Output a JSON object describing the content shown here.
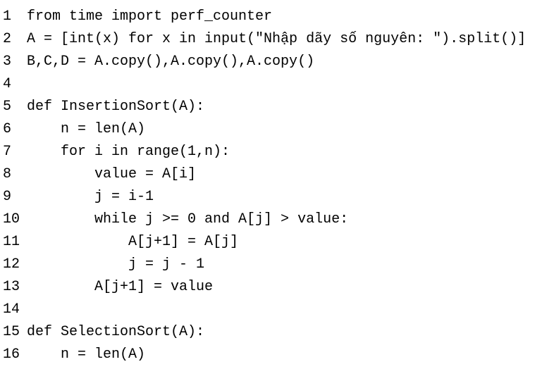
{
  "code": {
    "lines": [
      {
        "num": "1",
        "text": "from time import perf_counter"
      },
      {
        "num": "2",
        "text": "A = [int(x) for x in input(\"Nhập dãy số nguyên: \").split()]"
      },
      {
        "num": "3",
        "text": "B,C,D = A.copy(),A.copy(),A.copy()"
      },
      {
        "num": "4",
        "text": ""
      },
      {
        "num": "5",
        "text": "def InsertionSort(A):"
      },
      {
        "num": "6",
        "text": "    n = len(A)"
      },
      {
        "num": "7",
        "text": "    for i in range(1,n):"
      },
      {
        "num": "8",
        "text": "        value = A[i]"
      },
      {
        "num": "9",
        "text": "        j = i-1"
      },
      {
        "num": "10",
        "text": "        while j >= 0 and A[j] > value:"
      },
      {
        "num": "11",
        "text": "            A[j+1] = A[j]"
      },
      {
        "num": "12",
        "text": "            j = j - 1"
      },
      {
        "num": "13",
        "text": "        A[j+1] = value"
      },
      {
        "num": "14",
        "text": ""
      },
      {
        "num": "15",
        "text": "def SelectionSort(A):"
      },
      {
        "num": "16",
        "text": "    n = len(A)"
      }
    ]
  }
}
